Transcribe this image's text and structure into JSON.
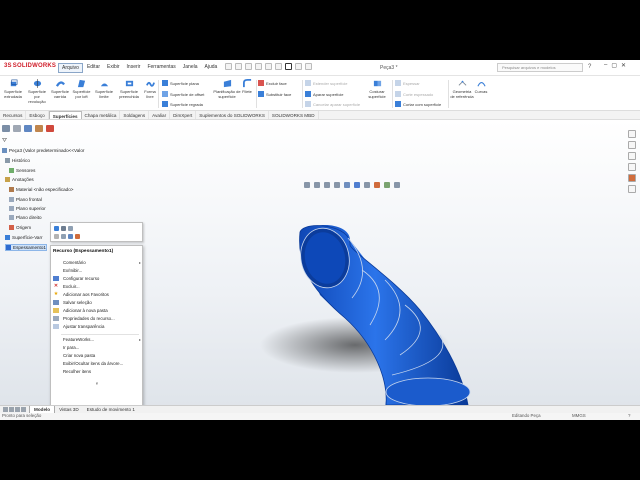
{
  "app": {
    "logo_text": "SOLIDWORKS",
    "logo_prefix": "3S",
    "menus": [
      "Arquivo",
      "Editar",
      "Exibir",
      "Inserir",
      "Ferramentas",
      "Janela",
      "Ajuda"
    ],
    "active_menu": "Arquivo",
    "document_title": "Peça3 *",
    "search_placeholder": "Pesquisar arquivos e modelos",
    "window_controls": [
      "–",
      "▢",
      "✕"
    ],
    "help_icons": [
      "?",
      "▾"
    ]
  },
  "ribbon": {
    "large_buttons": [
      {
        "label": "Superfície extrudada",
        "icon": "extruded-surface-icon"
      },
      {
        "label": "Superfície por revolução",
        "icon": "revolved-surface-icon"
      },
      {
        "label": "Superfície varrida",
        "icon": "swept-surface-icon"
      },
      {
        "label": "Superfície por loft",
        "icon": "lofted-surface-icon"
      },
      {
        "label": "Superfície limite",
        "icon": "boundary-surface-icon"
      },
      {
        "label": "Superfície preenchida",
        "icon": "filled-surface-icon"
      },
      {
        "label": "Forma livre",
        "icon": "freeform-icon"
      }
    ],
    "group1": [
      {
        "label": "Superfície plana",
        "disabled": false
      },
      {
        "label": "Superfície de offset",
        "disabled": false
      },
      {
        "label": "Superfície regrada",
        "disabled": false
      }
    ],
    "flatten_button": "Planificação de superfície",
    "fillet_button": "Filete",
    "group2": [
      {
        "label": "Excluir face",
        "disabled": false
      },
      {
        "label": "Substituir face",
        "disabled": false
      }
    ],
    "group3": [
      {
        "label": "Estender superfície",
        "disabled": true
      },
      {
        "label": "Aparar superfície",
        "disabled": false
      },
      {
        "label": "Cancelar aparar superfície",
        "disabled": true
      }
    ],
    "knit_button": "Costurar superfície",
    "group4": [
      {
        "label": "Espessar",
        "disabled": true
      },
      {
        "label": "Corte espessado",
        "disabled": true
      },
      {
        "label": "Cortar com superfície",
        "disabled": false
      }
    ],
    "ref_geometry": "Geometria de referência",
    "curves": "Curvas"
  },
  "tabs": [
    "Recursos",
    "Esboço",
    "Superfícies",
    "Chapa metálica",
    "Soldagens",
    "Avaliar",
    "DimXpert",
    "Suplementos do SOLIDWORKS",
    "SOLIDWORKS MBD"
  ],
  "active_tab": "Superfícies",
  "tree": {
    "root": "Peça3  (Valor predeterminado<<Valor",
    "items": [
      {
        "label": "Histórico",
        "icon": "history-icon"
      },
      {
        "label": "Sensores",
        "icon": "sensors-icon"
      },
      {
        "label": "Anotações",
        "icon": "annotations-icon"
      },
      {
        "label": "Material <não especificado>",
        "icon": "material-icon"
      },
      {
        "label": "Plano frontal",
        "icon": "plane-icon"
      },
      {
        "label": "Plano superior",
        "icon": "plane-icon"
      },
      {
        "label": "Plano direito",
        "icon": "plane-icon"
      },
      {
        "label": "Origem",
        "icon": "origin-icon"
      },
      {
        "label": "Superfície-Varr",
        "icon": "surface-sweep-icon"
      },
      {
        "label": "Espessamento1",
        "icon": "thicken-icon",
        "selected": true
      }
    ]
  },
  "context_menu": {
    "header": "Recurso (Espessamento1)",
    "items": [
      {
        "label": "Comentário",
        "submenu": true,
        "group": 1
      },
      {
        "label": "Ex/Inibir...",
        "group": 1
      },
      {
        "label": "Configurar recurso",
        "group": 1
      },
      {
        "label": "Excluir...",
        "group": 1
      },
      {
        "label": "Adicionar aos Favoritos",
        "group": 1
      },
      {
        "label": "Salvar seleção",
        "group": 1
      },
      {
        "label": "Adicionar à nova pasta",
        "group": 1
      },
      {
        "label": "Propriedades do recurso...",
        "group": 1
      },
      {
        "label": "Ajustar transparência",
        "group": 1
      },
      {
        "label": "FeatureWorks...",
        "submenu": true,
        "group": 2
      },
      {
        "label": "Ir para...",
        "group": 2
      },
      {
        "label": "Criar nova pasta",
        "group": 2
      },
      {
        "label": "Exibir/Ocultar itens da árvore...",
        "group": 2
      },
      {
        "label": "Recolher itens",
        "group": 2
      }
    ],
    "more": "»"
  },
  "bottom_tabs": [
    "Modelo",
    "Vistas 3D",
    "Estudo de movimento 1"
  ],
  "active_bottom_tab": "Modelo",
  "status": {
    "left": "Pronto para seleção",
    "editing": "Editando Peça",
    "units": "MMGS",
    "help": "?"
  },
  "colors": {
    "model_fill": "#1d62d6",
    "model_dark": "#0c3e9e",
    "edge": "#c7d6ee",
    "selection": "#cfe3fb",
    "brand": "#d01e2a"
  }
}
